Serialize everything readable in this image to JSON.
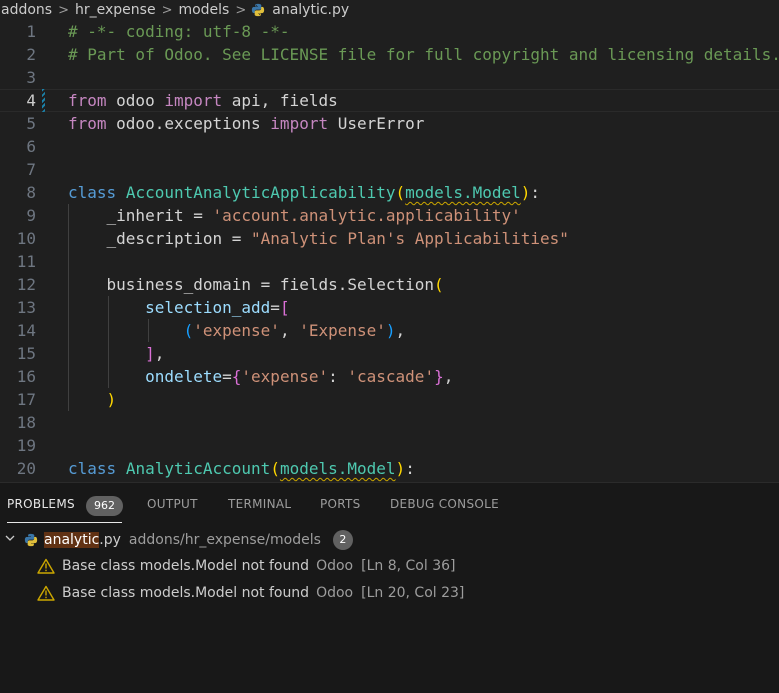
{
  "breadcrumb": {
    "items": [
      "addons",
      "hr_expense",
      "models"
    ],
    "file": "analytic.py"
  },
  "editor": {
    "active_line": 4,
    "modified_line": 4,
    "line_numbers": [
      "1",
      "2",
      "3",
      "4",
      "5",
      "6",
      "7",
      "8",
      "9",
      "10",
      "11",
      "12",
      "13",
      "14",
      "15",
      "16",
      "17",
      "18",
      "19",
      "20"
    ],
    "lines": [
      [
        [
          "c-com",
          "# -*- coding: utf-8 -*-"
        ]
      ],
      [
        [
          "c-com",
          "# Part of Odoo. See LICENSE file for full copyright and licensing details."
        ]
      ],
      [],
      [
        [
          "c-kw",
          "from"
        ],
        [
          "c-def",
          " odoo "
        ],
        [
          "c-kw",
          "import"
        ],
        [
          "c-def",
          " api, fields"
        ]
      ],
      [
        [
          "c-kw",
          "from"
        ],
        [
          "c-def",
          " odoo.exceptions "
        ],
        [
          "c-kw",
          "import"
        ],
        [
          "c-def",
          " UserError"
        ]
      ],
      [],
      [],
      [
        [
          "c-blue",
          "class"
        ],
        [
          "c-def",
          " "
        ],
        [
          "c-cls",
          "AccountAnalyticApplicability"
        ],
        [
          "c-p1",
          "("
        ],
        [
          "c-cls squig",
          "models.Model"
        ],
        [
          "c-p1",
          ")"
        ],
        [
          "c-def",
          ":"
        ]
      ],
      [
        [
          "c-def",
          "    _inherit = "
        ],
        [
          "c-str",
          "'account.analytic.applicability'"
        ]
      ],
      [
        [
          "c-def",
          "    _description = "
        ],
        [
          "c-str",
          "\"Analytic Plan's Applicabilities\""
        ]
      ],
      [],
      [
        [
          "c-def",
          "    business_domain = fields.Selection"
        ],
        [
          "c-p1",
          "("
        ]
      ],
      [
        [
          "c-def",
          "        "
        ],
        [
          "c-var",
          "selection_add"
        ],
        [
          "c-def",
          "="
        ],
        [
          "c-p2",
          "["
        ]
      ],
      [
        [
          "c-def",
          "            "
        ],
        [
          "c-p3",
          "("
        ],
        [
          "c-str",
          "'expense'"
        ],
        [
          "c-def",
          ", "
        ],
        [
          "c-str",
          "'Expense'"
        ],
        [
          "c-p3",
          ")"
        ],
        [
          "c-def",
          ","
        ]
      ],
      [
        [
          "c-def",
          "        "
        ],
        [
          "c-p2",
          "]"
        ],
        [
          "c-def",
          ","
        ]
      ],
      [
        [
          "c-def",
          "        "
        ],
        [
          "c-var",
          "ondelete"
        ],
        [
          "c-def",
          "="
        ],
        [
          "c-p2",
          "{"
        ],
        [
          "c-str",
          "'expense'"
        ],
        [
          "c-def",
          ": "
        ],
        [
          "c-str",
          "'cascade'"
        ],
        [
          "c-p2",
          "}"
        ],
        [
          "c-def",
          ","
        ]
      ],
      [
        [
          "c-def",
          "    "
        ],
        [
          "c-p1",
          ")"
        ]
      ],
      [],
      [],
      [
        [
          "c-blue",
          "class"
        ],
        [
          "c-def",
          " "
        ],
        [
          "c-cls",
          "AnalyticAccount"
        ],
        [
          "c-p1",
          "("
        ],
        [
          "c-cls squig",
          "models.Model"
        ],
        [
          "c-p1",
          ")"
        ],
        [
          "c-def",
          ":"
        ]
      ]
    ]
  },
  "panel": {
    "tabs": [
      {
        "label": "PROBLEMS",
        "active": true
      },
      {
        "label": "OUTPUT",
        "active": false
      },
      {
        "label": "TERMINAL",
        "active": false
      },
      {
        "label": "PORTS",
        "active": false
      },
      {
        "label": "DEBUG CONSOLE",
        "active": false
      }
    ],
    "problems_count": "962",
    "file_group": {
      "name_highlight": "analytic",
      "name_rest": ".py",
      "path": "addons/hr_expense/models",
      "count": "2"
    },
    "problems": [
      {
        "message": "Base class models.Model not found",
        "source": "Odoo",
        "location": "[Ln 8, Col 36]"
      },
      {
        "message": "Base class models.Model not found",
        "source": "Odoo",
        "location": "[Ln 20, Col 23]"
      }
    ]
  },
  "icons": {
    "file": "python-file-icon",
    "warning": "warning-icon",
    "chevron": "chevron-down-icon"
  },
  "colors": {
    "editor_bg": "#1f1f1f",
    "comment": "#6a9955",
    "keyword": "#c586c0",
    "class": "#4ec9b0",
    "string": "#ce9178",
    "warning": "#cca700"
  }
}
